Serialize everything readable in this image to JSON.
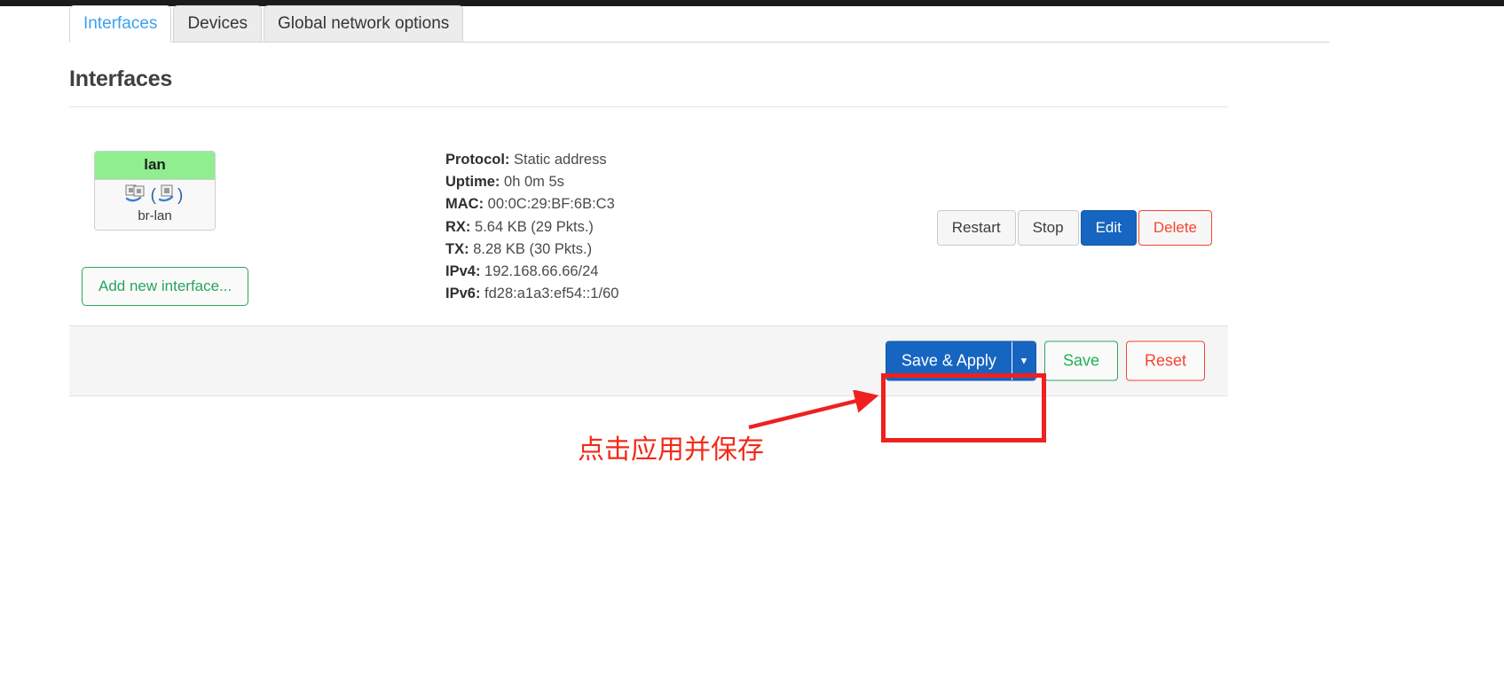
{
  "tabs": [
    {
      "label": "Interfaces",
      "active": true
    },
    {
      "label": "Devices",
      "active": false
    },
    {
      "label": "Global network options",
      "active": false
    }
  ],
  "page": {
    "title": "Interfaces"
  },
  "interface": {
    "badge_name": "lan",
    "device_name": "br-lan",
    "icon_left": "ethernet-ports-icon",
    "icon_right": "ethernet-port-bracketed-icon",
    "details": [
      {
        "label": "Protocol:",
        "value": "Static address"
      },
      {
        "label": "Uptime:",
        "value": "0h 0m 5s"
      },
      {
        "label": "MAC:",
        "value": "00:0C:29:BF:6B:C3"
      },
      {
        "label": "RX:",
        "value": "5.64 KB (29 Pkts.)"
      },
      {
        "label": "TX:",
        "value": "8.28 KB (30 Pkts.)"
      },
      {
        "label": "IPv4:",
        "value": "192.168.66.66/24"
      },
      {
        "label": "IPv6:",
        "value": "fd28:a1a3:ef54::1/60"
      }
    ],
    "actions": {
      "restart": "Restart",
      "stop": "Stop",
      "edit": "Edit",
      "delete": "Delete"
    }
  },
  "add_interface": {
    "label": "Add new interface..."
  },
  "footer": {
    "save_apply": "Save & Apply",
    "dropdown_caret": "▼",
    "save": "Save",
    "reset": "Reset"
  },
  "annotation": {
    "text": "点击应用并保存",
    "color": "#f22a18"
  },
  "colors": {
    "primary_blue": "#1665c0",
    "success_green": "#28a45c",
    "danger_red": "#f4452f",
    "badge_green": "#90ee90",
    "annotation_red": "#ef2020",
    "tab_active_text": "#3aa3f0"
  }
}
